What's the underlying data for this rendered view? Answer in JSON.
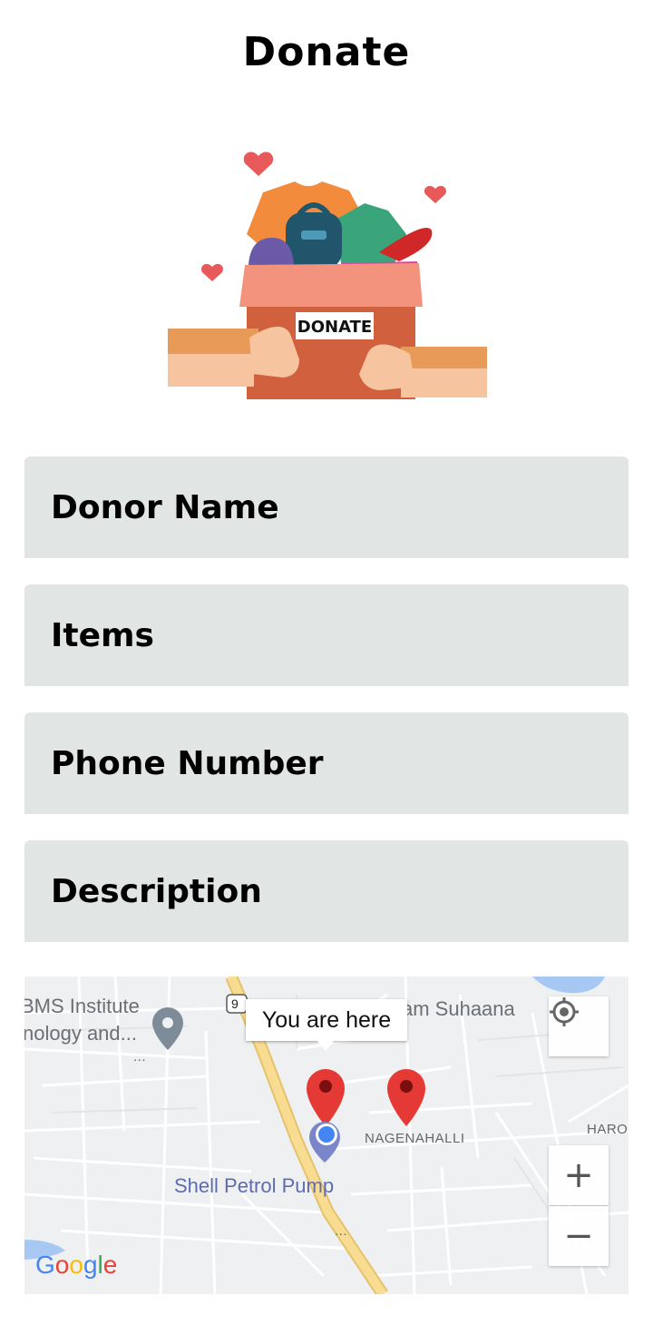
{
  "page": {
    "title": "Donate"
  },
  "illustration": {
    "box_label": "DONATE"
  },
  "form": {
    "donor_name": {
      "placeholder": "Donor Name"
    },
    "items": {
      "placeholder": "Items"
    },
    "phone_number": {
      "placeholder": "Phone Number"
    },
    "description": {
      "placeholder": "Description"
    }
  },
  "map": {
    "tooltip": "You are here",
    "labels": {
      "institute_line1": "BMS Institute",
      "institute_line2": "nology and...",
      "ellipsis": "...",
      "suhaana": "am Suhaana",
      "shell": "Shell Petrol Pump",
      "nagenahalli": "NAGENAHALLI",
      "haro": "HARO",
      "route_shield": "9"
    },
    "controls": {
      "locate_icon": "my-location-icon",
      "zoom_in": "+",
      "zoom_out": "−"
    },
    "attribution": {
      "G": "G",
      "o1": "o",
      "o2": "o",
      "g": "g",
      "l": "l",
      "e": "e"
    },
    "colors": {
      "marker": "#e53935",
      "user_dot": "#4285f4",
      "highway": "#f7d88a"
    }
  }
}
